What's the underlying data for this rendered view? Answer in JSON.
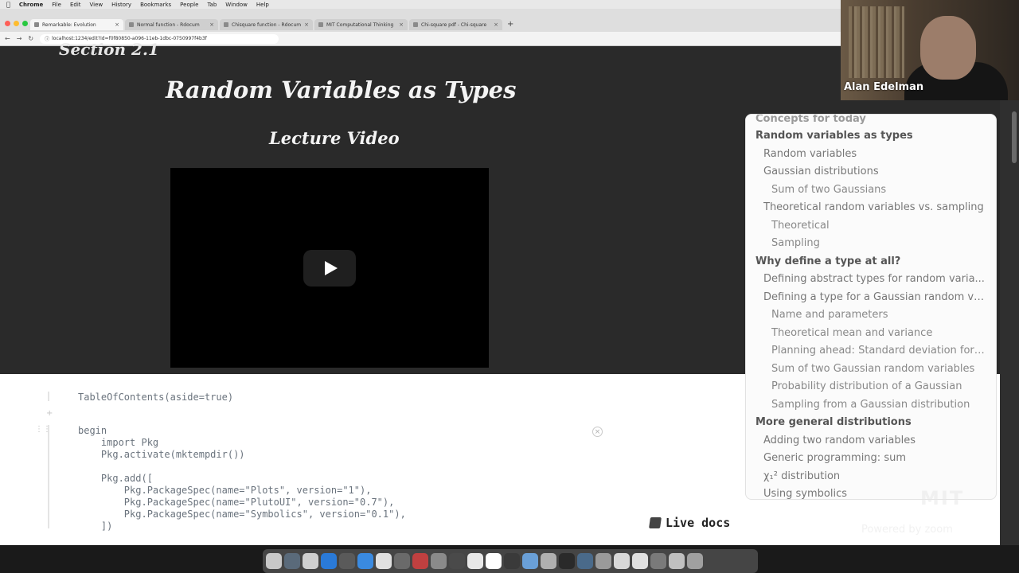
{
  "menubar": {
    "items": [
      "Chrome",
      "File",
      "Edit",
      "View",
      "History",
      "Bookmarks",
      "People",
      "Tab",
      "Window",
      "Help"
    ]
  },
  "browser": {
    "tabs": [
      {
        "label": "Remarkable: Evolution",
        "active": true
      },
      {
        "label": "Normal function - Rdocum",
        "active": false
      },
      {
        "label": "Chisquare function - Rdocum",
        "active": false
      },
      {
        "label": "MIT Computational Thinking",
        "active": false
      },
      {
        "label": "Chi-square pdf - Chi-square",
        "active": false
      }
    ],
    "new_tab": "+",
    "url": "localhost:1234/edit?id=f0f80850-a096-11eb-1dbc-0750997f4b3f"
  },
  "notebook": {
    "section_title": "Section 2.1",
    "title": "Random Variables as Types",
    "subtitle": "Lecture Video"
  },
  "code": {
    "toc_call": "TableOfContents(aside=true)",
    "lines": [
      "begin",
      "    import Pkg",
      "    Pkg.activate(mktempdir())",
      "",
      "    Pkg.add([",
      "        Pkg.PackageSpec(name=\"Plots\", version=\"1\"),",
      "        Pkg.PackageSpec(name=\"PlutoUI\", version=\"0.7\"),",
      "        Pkg.PackageSpec(name=\"Symbolics\", version=\"0.1\"),",
      "    ])"
    ]
  },
  "live_docs": "Live docs",
  "toc": {
    "header": "Concepts for today",
    "items": [
      {
        "level": 1,
        "label": "Random variables as types"
      },
      {
        "level": 2,
        "label": "Random variables"
      },
      {
        "level": 2,
        "label": "Gaussian distributions"
      },
      {
        "level": 3,
        "label": "Sum of two Gaussians"
      },
      {
        "level": 2,
        "label": "Theoretical random variables vs. sampling"
      },
      {
        "level": 3,
        "label": "Theoretical"
      },
      {
        "level": 3,
        "label": "Sampling"
      },
      {
        "level": 1,
        "label": "Why define a type at all?"
      },
      {
        "level": 2,
        "label": "Defining abstract types for random varia..."
      },
      {
        "level": 2,
        "label": "Defining a type for a Gaussian random va..."
      },
      {
        "level": 3,
        "label": "Name and parameters"
      },
      {
        "level": 3,
        "label": "Theoretical mean and variance"
      },
      {
        "level": 3,
        "label": "Planning ahead: Standard deviation for ..."
      },
      {
        "level": 3,
        "label": "Sum of two Gaussian random variables"
      },
      {
        "level": 3,
        "label": "Probability distribution of a Gaussian"
      },
      {
        "level": 3,
        "label": "Sampling from a Gaussian distribution"
      },
      {
        "level": 1,
        "label": "More general distributions"
      },
      {
        "level": 2,
        "label": "Adding two random variables"
      },
      {
        "level": 2,
        "label": "Generic programming: sum"
      },
      {
        "level": 2,
        "label": "χ₁² distribution"
      },
      {
        "level": 2,
        "label": "Using symbolics"
      }
    ]
  },
  "webcam": {
    "name": "Alan Edelman"
  },
  "watermarks": {
    "mit": "MIT",
    "zoom": "Powered by zoom"
  },
  "colors": {
    "page_bg": "#2a2a2a",
    "code_bg": "#ffffff",
    "toc_bg": "#fbfbfb"
  }
}
